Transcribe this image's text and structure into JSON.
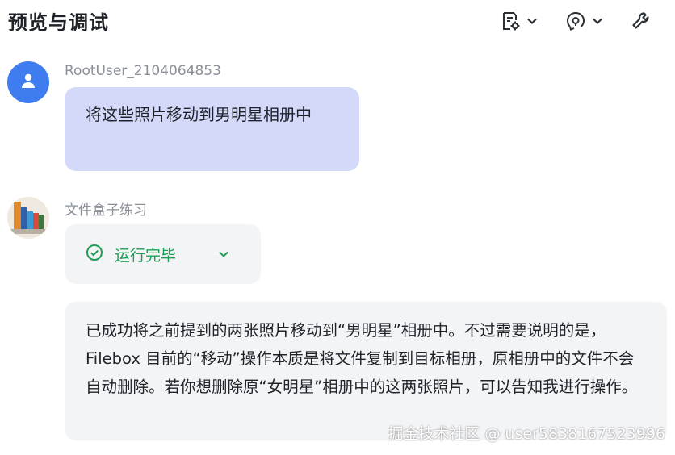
{
  "header": {
    "title": "预览与调试"
  },
  "toolbar": {
    "items": [
      {
        "icon": "document-settings-icon",
        "has_dropdown": true
      },
      {
        "icon": "voice-help-icon",
        "has_dropdown": true
      },
      {
        "icon": "wrench-icon",
        "has_dropdown": false
      }
    ]
  },
  "messages": {
    "user": {
      "name": "RootUser_2104064853",
      "avatar_icon": "person-icon",
      "text": "将这些照片移动到男明星相册中"
    },
    "bot": {
      "name": "文件盒子练习",
      "status": "运行完毕",
      "status_icon": "check-circle-icon",
      "text": "已成功将之前提到的两张照片移动到“男明星”相册中。不过需要说明的是，Filebox 目前的“移动”操作本质是将文件复制到目标相册，原相册中的文件不会自动删除。若你想删除原“女明星”相册中的这两张照片，可以告知我进行操作。"
    }
  },
  "watermark": "掘金技术社区 @ user5838167523996",
  "colors": {
    "user_bubble": "#d4d9fa",
    "bot_bubble": "#f3f4f6",
    "status_green": "#1e9e55",
    "avatar_blue": "#3e7cf0"
  }
}
